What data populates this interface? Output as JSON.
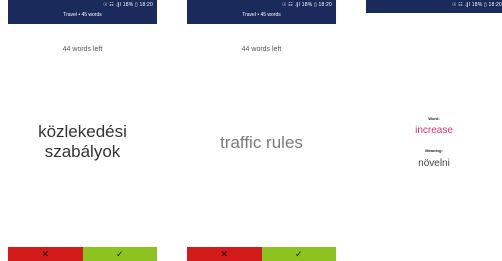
{
  "status_bar": "☉ ☷ .∥l 18% ▯ 18:20",
  "screens": [
    {
      "app_title": "Travel • 45 words",
      "words_left": "44 words left",
      "card_line1": "közlekedési",
      "card_line2": "szabályok",
      "no_label": "✕",
      "yes_label": "✓"
    },
    {
      "app_title": "Travel • 45 words",
      "words_left": "44 words left",
      "card_line1": "traffic rules",
      "no_label": "✕",
      "yes_label": "✓"
    },
    {
      "word_label": "Word:",
      "word": "increase",
      "meaning_label": "Meaning:",
      "meaning": "növelni"
    }
  ],
  "colors": {
    "header_bg": "#1a2a5a",
    "no_button": "#d21a1a",
    "yes_button": "#8cc31f",
    "word_accent": "#e4326b"
  }
}
